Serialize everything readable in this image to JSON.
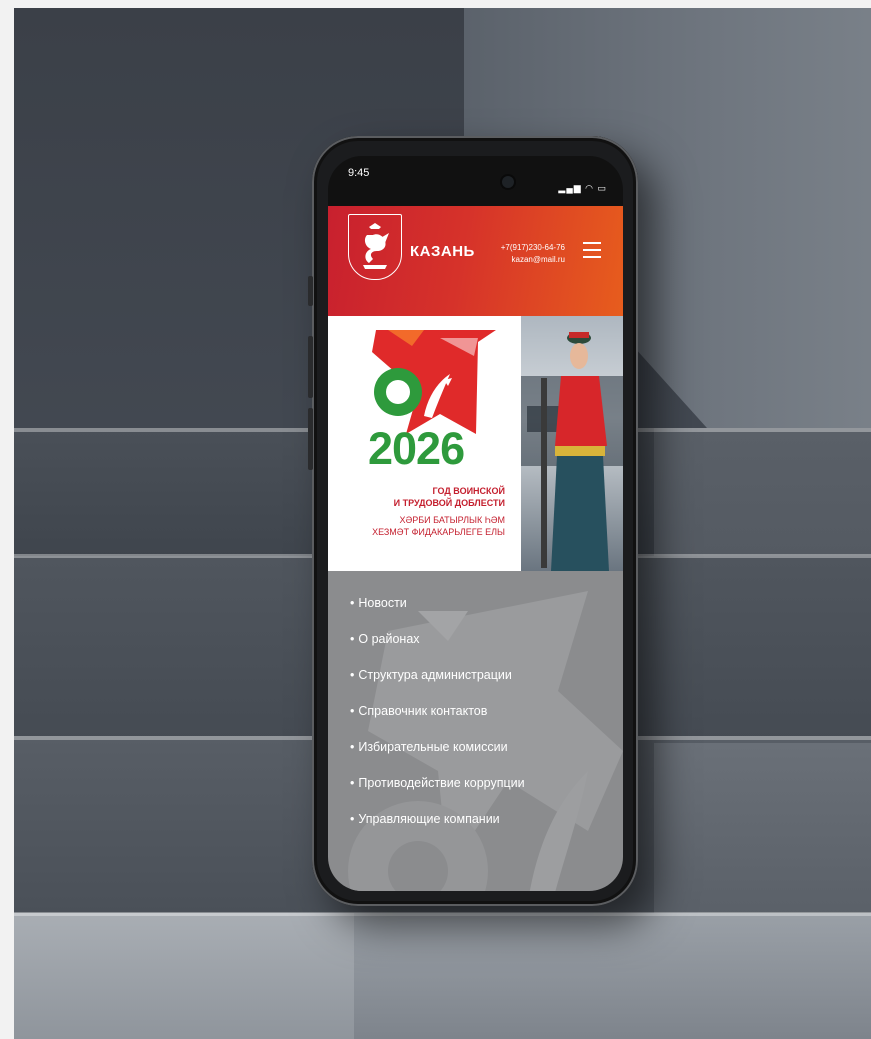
{
  "status_bar": {
    "time": "9:45",
    "icons": "signal-wifi-battery"
  },
  "header": {
    "city": "КАЗАНЬ",
    "phone": "+7(917)230-64-76",
    "email": "kazan@mail.ru",
    "menu_icon": "hamburger-icon"
  },
  "banner": {
    "year": "2026",
    "line1": "ГОД ВОИНСКОЙ",
    "line2": "И ТРУДОВОЙ ДОБЛЕСТИ",
    "line3": "ХӘРБИ БАТЫРЛЫК ҺӘМ",
    "line4": "ХЕЗМӘТ ФИДАКАРЬЛЕГЕ ЕЛЫ",
    "colors": {
      "green": "#2e9a3c",
      "red": "#c41f2e"
    }
  },
  "menu": {
    "items": [
      {
        "label": "Новости"
      },
      {
        "label": "О районах"
      },
      {
        "label": "Структура администрации"
      },
      {
        "label": "Справочник контактов"
      },
      {
        "label": "Избирательные комиссии"
      },
      {
        "label": "Противодействие коррупции"
      },
      {
        "label": "Управляющие компании"
      }
    ]
  },
  "theme": {
    "header_start": "#c8202e",
    "header_end": "#e75d1d",
    "menu_bg": "#8b8c8e"
  }
}
